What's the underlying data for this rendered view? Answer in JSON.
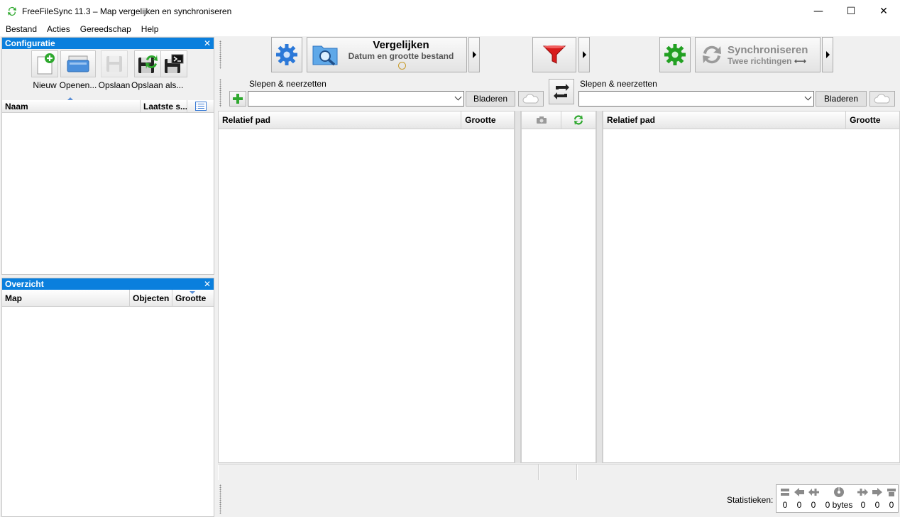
{
  "window": {
    "title": "FreeFileSync 11.3 – Map vergelijken en synchroniseren",
    "minimize": "—",
    "maximize": "☐",
    "close": "✕"
  },
  "menu": [
    "Bestand",
    "Acties",
    "Gereedschap",
    "Help"
  ],
  "config_pane": {
    "title": "Configuratie",
    "tools": [
      {
        "label": "Nieuw",
        "icon": "new-config-icon",
        "enabled": true
      },
      {
        "label": "Openen...",
        "icon": "open-config-icon",
        "enabled": true
      },
      {
        "label": "Opslaan",
        "icon": "save-icon",
        "enabled": false
      },
      {
        "label": "Opslaan als...",
        "icon": "save-as-icon",
        "enabled": true
      },
      {
        "label": "",
        "icon": "save-as-batch-icon",
        "enabled": true
      }
    ],
    "columns": [
      "Naam",
      "Laatste s..."
    ],
    "sorted_column": "Naam"
  },
  "overview_pane": {
    "title": "Overzicht",
    "columns": [
      "Map",
      "Objecten",
      "Grootte"
    ],
    "sorted_column": "Grootte"
  },
  "toolbar": {
    "compare_title": "Vergelijken",
    "compare_sub": "Datum en grootte bestand",
    "sync_title": "Synchroniseren",
    "sync_sub": "Twee richtingen",
    "colors": {
      "gear_blue": "#2b78d8",
      "filter_red": "#d81b1b",
      "gear_green": "#22a022",
      "sync_disabled": "#9a9a9a"
    }
  },
  "folder_left": {
    "drop_label": "Slepen & neerzetten",
    "path": "",
    "browse": "Bladeren"
  },
  "folder_right": {
    "drop_label": "Slepen & neerzetten",
    "path": "",
    "browse": "Bladeren"
  },
  "grid_left": {
    "columns": [
      "Relatief pad",
      "Grootte"
    ]
  },
  "grid_right": {
    "columns": [
      "Relatief pad",
      "Grootte"
    ]
  },
  "statistics": {
    "label": "Statistieken:",
    "values": [
      "0",
      "0",
      "0",
      "0 bytes",
      "0",
      "0",
      "0"
    ]
  }
}
